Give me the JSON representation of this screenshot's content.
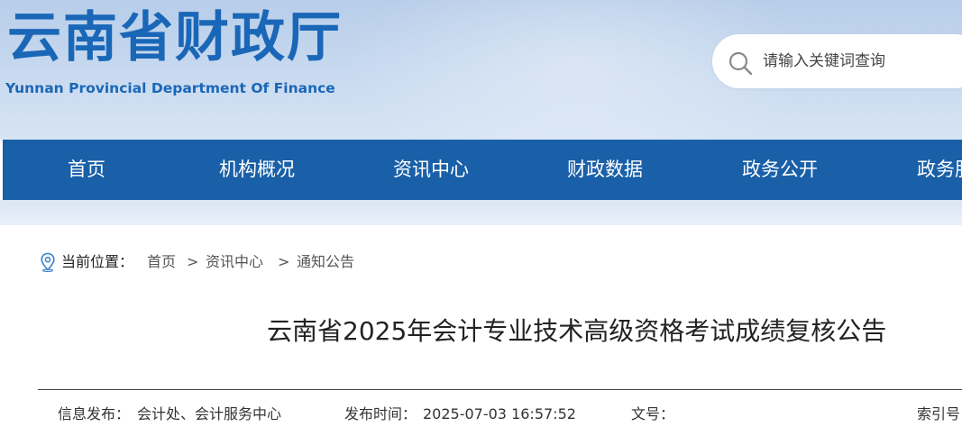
{
  "site": {
    "title_cn": "云南省财政厅",
    "title_en": "Yunnan Provincial Department Of Finance"
  },
  "search": {
    "placeholder": "请输入关键词查询",
    "icon": "search-icon"
  },
  "nav": {
    "items": [
      {
        "label": "首页"
      },
      {
        "label": "机构概况"
      },
      {
        "label": "资讯中心"
      },
      {
        "label": "财政数据"
      },
      {
        "label": "政务公开"
      },
      {
        "label": "政务服"
      }
    ]
  },
  "breadcrumb": {
    "icon": "location-pin-icon",
    "label": "当前位置：",
    "items": [
      "首页",
      "资讯中心",
      "通知公告"
    ],
    "separator": ">"
  },
  "article": {
    "title": "云南省2025年会计专业技术高级资格考试成绩复核公告",
    "meta": {
      "publisher_label": "信息发布：",
      "publisher_value": "会计处、会计服务中心",
      "time_label": "发布时间：",
      "time_value": "2025-07-03 16:57:52",
      "doc_no_label": "文号：",
      "doc_no_value": "",
      "index_label": "索引号"
    }
  },
  "colors": {
    "brand_blue": "#1a67b8",
    "nav_blue": "#1a60a8",
    "header_bg": "#c5d8ef"
  }
}
